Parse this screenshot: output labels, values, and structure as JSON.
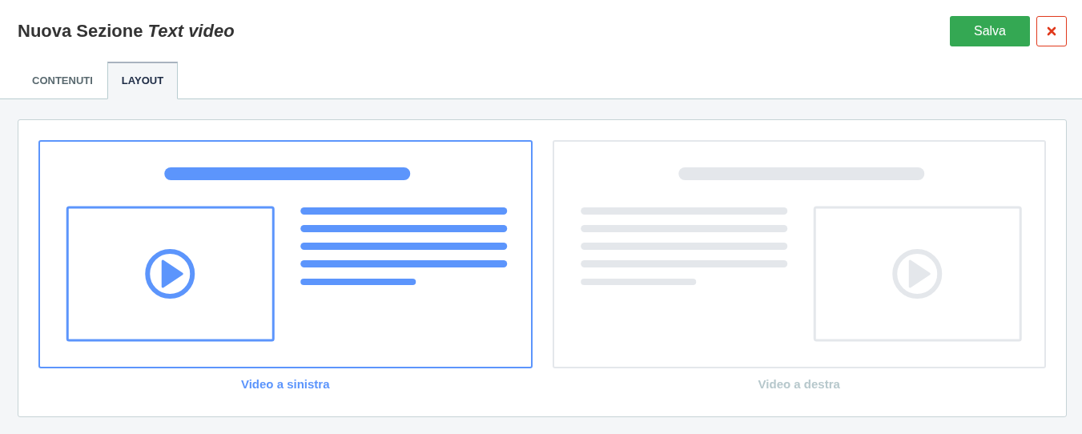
{
  "header": {
    "title": "Nuova Sezione *Text video*",
    "save_button": "Salva"
  },
  "tabs": [
    {
      "label": "CONTENUTI",
      "selected": false
    },
    {
      "label": "LAYOUT",
      "selected": true
    }
  ],
  "layout_options": [
    {
      "kind": "video_left",
      "label": "Video a sinistra",
      "selected": true
    },
    {
      "kind": "video_right",
      "label": "Video a destra",
      "selected": false
    }
  ]
}
